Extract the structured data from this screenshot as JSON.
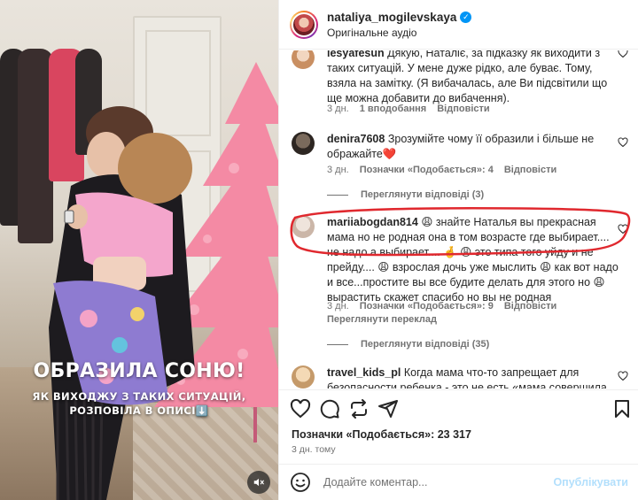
{
  "media": {
    "caption_title": "ОБРАЗИЛА СОНЮ!",
    "caption_line1": "ЯК ВИХОДЖУ З ТАКИХ СИТУАЦІЙ,",
    "caption_line2": "РОЗПОВІЛА В ОПИСІ⬇️",
    "sound_icon": "speaker-muted-icon"
  },
  "header": {
    "username": "nataliya_mogilevskaya",
    "verified": true,
    "audio": "Оригінальне аудіо"
  },
  "comments": [
    {
      "username": "lesyafesun",
      "text": "Дякую, Наталіє, за підказку як виходити з таких ситуацій. У мене дуже рідко, але буває. Тому, взяла на замітку. (Я вибачалась, але Ви підсвітили що ще можна добавити до вибачення).",
      "time": "3 дн.",
      "likes": "1 вподобання",
      "reply": "Відповісти"
    },
    {
      "username": "denira7608",
      "text": "Зрозумійте чому її образили і більше не ображайте❤️",
      "time": "3 дн.",
      "likes": "Позначки «Подобається»: 4",
      "reply": "Відповісти",
      "view_replies": "Переглянути відповіді (3)"
    },
    {
      "username": "mariiabogdan814",
      "text": "😩 знайте Наталья вы прекрасная мама но не родная она в том возрасте где выбирает.... не надо а выбирает.... 🤞 😩 это типа того уйду и не прейду.... 😩 взрослая дочь уже мыслить 😩 как вот надо и все...простите вы все будите делать для этого но 😩 вырастить скажет спасибо но вы не родная",
      "time": "3 дн.",
      "likes": "Позначки «Подобається»: 9",
      "reply": "Відповісти",
      "translate": "Переглянути переклад",
      "view_replies": "Переглянути відповіді (35)"
    },
    {
      "username": "travel_kids_pl",
      "text": "Когда мама что-то запрещает для безопасности ребенка - это не есть «мама совершила",
      "time": "",
      "likes": "",
      "reply": ""
    }
  ],
  "actions": {
    "like_icon": "heart-icon",
    "comment_icon": "comment-icon",
    "repost_icon": "repost-icon",
    "share_icon": "paper-plane-icon",
    "save_icon": "bookmark-icon"
  },
  "likes_text": "Позначки «Подобається»: 23 317",
  "post_date": "3 дн. тому",
  "composer": {
    "placeholder": "Додайте коментар...",
    "post_label": "Опублікувати",
    "emoji_icon": "smiley-icon"
  },
  "colors": {
    "accent_blue": "#0095f6",
    "annotation_red": "#e0282e",
    "tree_pink": "#f48aa4"
  }
}
